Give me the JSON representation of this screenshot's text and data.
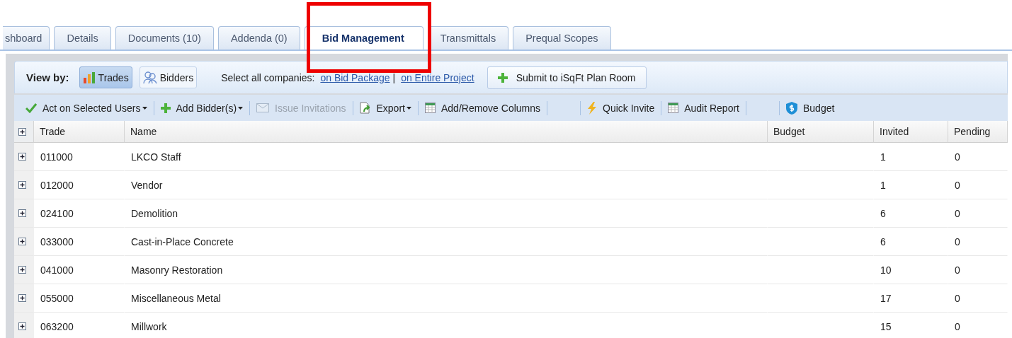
{
  "tabs": [
    {
      "label": "shboard",
      "selected": false
    },
    {
      "label": "Details",
      "selected": false
    },
    {
      "label": "Documents (10)",
      "selected": false
    },
    {
      "label": "Addenda (0)",
      "selected": false
    },
    {
      "label": "Bid Management",
      "selected": true
    },
    {
      "label": "Transmittals",
      "selected": false
    },
    {
      "label": "Prequal Scopes",
      "selected": false
    }
  ],
  "view_by": {
    "label": "View by:",
    "options": [
      {
        "label": "Trades",
        "kind": "chart",
        "selected": true
      },
      {
        "label": "Bidders",
        "kind": "people",
        "selected": false
      }
    ]
  },
  "select_all": {
    "label": "Select all companies:",
    "links": [
      "on Bid Package",
      "on Entire Project"
    ],
    "separator": "|"
  },
  "submit_button": "Submit to iSqFt Plan Room",
  "actions": [
    {
      "kind": "check",
      "label": "Act on Selected Users",
      "dropdown": true,
      "disabled": false
    },
    {
      "kind": "plus",
      "label": "Add Bidder(s)",
      "dropdown": true,
      "disabled": false
    },
    {
      "kind": "mail",
      "label": "Issue Invitations",
      "dropdown": false,
      "disabled": true
    },
    {
      "kind": "export",
      "label": "Export",
      "dropdown": true,
      "disabled": false
    },
    {
      "kind": "grid",
      "label": "Add/Remove Columns",
      "dropdown": false,
      "disabled": false
    },
    {
      "kind": "spacer"
    },
    {
      "kind": "bolt",
      "label": "Quick Invite",
      "dropdown": false,
      "disabled": false
    },
    {
      "kind": "grid",
      "label": "Audit Report",
      "dropdown": false,
      "disabled": false
    },
    {
      "kind": "spacer"
    },
    {
      "kind": "shield",
      "label": "Budget",
      "dropdown": false,
      "disabled": false
    }
  ],
  "table": {
    "columns": [
      "Trade",
      "Name",
      "Budget",
      "Invited",
      "Pending"
    ],
    "rows": [
      {
        "expanded": false,
        "trade": "011000",
        "name": "LKCO Staff",
        "invited": "1",
        "pending": "0"
      },
      {
        "expanded": false,
        "trade": "012000",
        "name": "Vendor",
        "invited": "1",
        "pending": "0"
      },
      {
        "expanded": false,
        "trade": "024100",
        "name": "Demolition",
        "invited": "6",
        "pending": "0"
      },
      {
        "expanded": false,
        "trade": "033000",
        "name": "Cast-in-Place Concrete",
        "invited": "6",
        "pending": "0"
      },
      {
        "expanded": false,
        "trade": "041000",
        "name": "Masonry Restoration",
        "invited": "10",
        "pending": "0"
      },
      {
        "expanded": false,
        "trade": "055000",
        "name": "Miscellaneous Metal",
        "invited": "17",
        "pending": "0"
      },
      {
        "expanded": false,
        "trade": "063200",
        "name": "Millwork",
        "invited": "15",
        "pending": "0"
      }
    ]
  }
}
